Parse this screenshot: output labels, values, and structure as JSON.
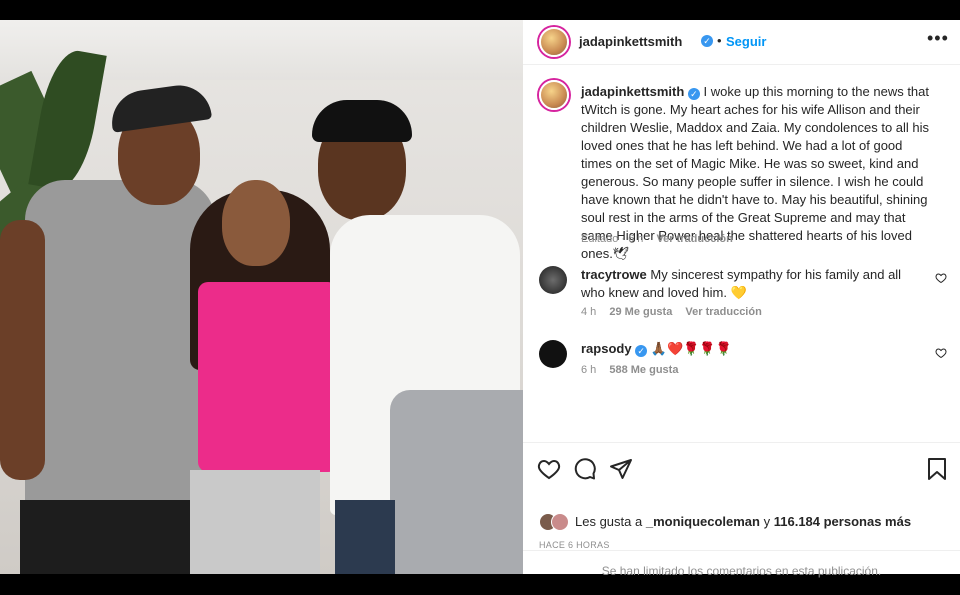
{
  "post": {
    "author": "jadapinkettsmith",
    "follow_label": "Seguir",
    "menu_icon": "more-options-icon",
    "caption": "I woke up this morning to the news that tWitch is gone. My heart aches for his wife Allison and their children Weslie, Maddox and Zaia. My condolences to all his loved ones that he has left behind. We had a lot of good times on the set of Magic Mike. He was so sweet, kind and generous. So many people suffer in silence. I wish he could have known that he didn't have to. May his beautiful, shining soul rest in the arms of the Great Supreme and may that same Higher Power heal the shattered hearts of his loved ones.🕊",
    "caption_meta": {
      "edited": "Editado · 6 h",
      "translate": "Ver traducción"
    }
  },
  "comments": [
    {
      "user": "tracytrowe",
      "text": "My sincerest sympathy for his family and all who knew and loved him. 💛",
      "time": "4 h",
      "likes": "29 Me gusta",
      "translate": "Ver traducción",
      "verified": false
    },
    {
      "user": "rapsody",
      "text": "🙏🏾❤️🌹🌹🌹",
      "time": "6 h",
      "likes": "588 Me gusta",
      "verified": true
    }
  ],
  "actions": {
    "likes_prefix": "Les gusta a",
    "liked_by_user": "_moniquecoleman",
    "likes_suffix": "y",
    "others": "116.184 personas más",
    "timestamp": "HACE 6 HORAS"
  },
  "footer": {
    "notice": "Se han limitado los comentarios en esta publicación."
  },
  "colors": {
    "link": "#0095f6",
    "verified": "#3897f0",
    "text": "#262626",
    "muted": "#8e8e8e"
  }
}
